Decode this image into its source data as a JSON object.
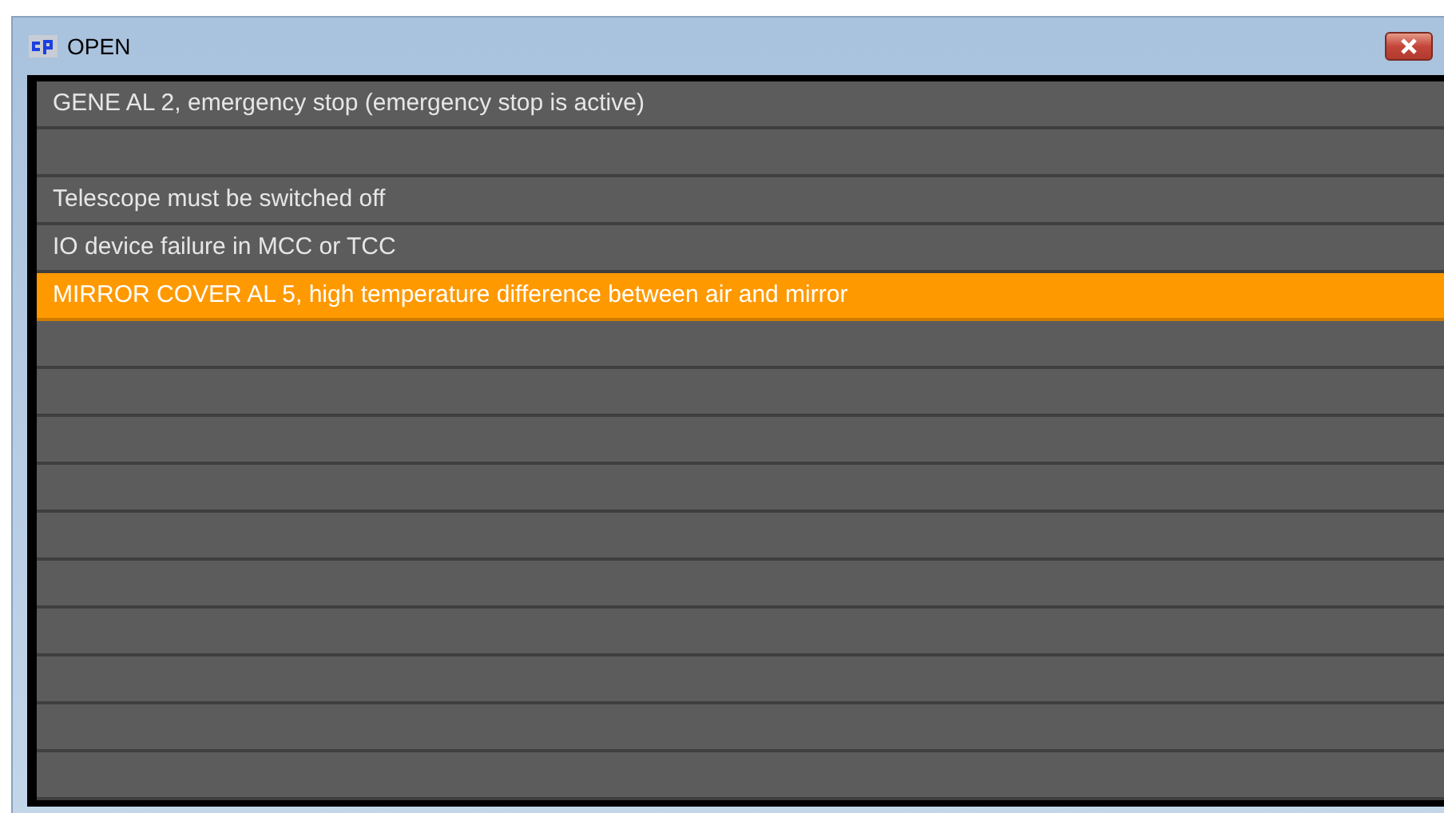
{
  "window": {
    "title": "OPEN"
  },
  "rows": [
    {
      "text": "GENE AL 2, emergency stop (emergency stop is active)",
      "selected": false
    },
    {
      "selected": false
    },
    {
      "text": "Telescope must be switched off",
      "selected": false
    },
    {
      "text": "IO device failure in MCC or TCC",
      "selected": false
    },
    {
      "text": "MIRROR COVER AL 5, high temperature difference between air and mirror",
      "selected": true
    },
    {
      "selected": false
    },
    {
      "selected": false
    },
    {
      "selected": false
    },
    {
      "selected": false
    },
    {
      "selected": false
    },
    {
      "selected": false
    },
    {
      "selected": false
    },
    {
      "selected": false
    },
    {
      "selected": false
    },
    {
      "selected": false
    }
  ]
}
